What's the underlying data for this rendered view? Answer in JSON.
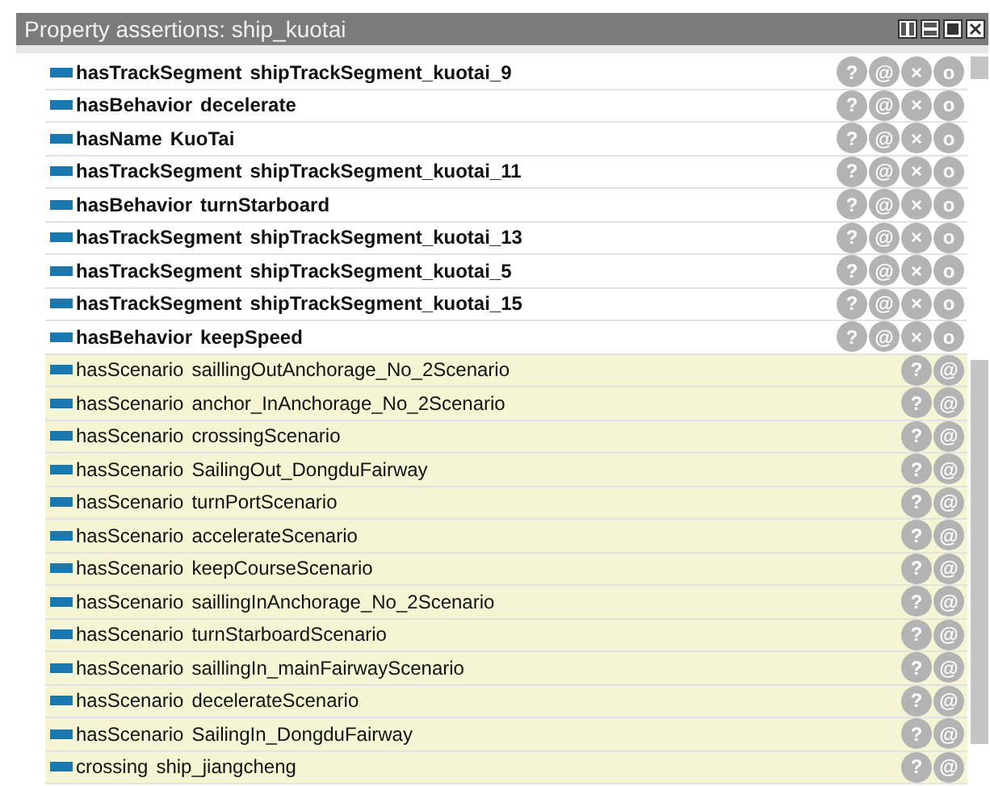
{
  "window": {
    "title": "Property assertions: ship_kuotai"
  },
  "rows": [
    {
      "kind": "asserted",
      "property": "hasTrackSegment",
      "value": "shipTrackSegment_kuotai_9",
      "buttons": [
        "?",
        "@",
        "×",
        "o"
      ]
    },
    {
      "kind": "asserted",
      "property": "hasBehavior",
      "value": "decelerate",
      "buttons": [
        "?",
        "@",
        "×",
        "o"
      ]
    },
    {
      "kind": "asserted",
      "property": "hasName",
      "value": "KuoTai",
      "buttons": [
        "?",
        "@",
        "×",
        "o"
      ]
    },
    {
      "kind": "asserted",
      "property": "hasTrackSegment",
      "value": "shipTrackSegment_kuotai_11",
      "buttons": [
        "?",
        "@",
        "×",
        "o"
      ]
    },
    {
      "kind": "asserted",
      "property": "hasBehavior",
      "value": "turnStarboard",
      "buttons": [
        "?",
        "@",
        "×",
        "o"
      ]
    },
    {
      "kind": "asserted",
      "property": "hasTrackSegment",
      "value": "shipTrackSegment_kuotai_13",
      "buttons": [
        "?",
        "@",
        "×",
        "o"
      ]
    },
    {
      "kind": "asserted",
      "property": "hasTrackSegment",
      "value": "shipTrackSegment_kuotai_5",
      "buttons": [
        "?",
        "@",
        "×",
        "o"
      ]
    },
    {
      "kind": "asserted",
      "property": "hasTrackSegment",
      "value": "shipTrackSegment_kuotai_15",
      "buttons": [
        "?",
        "@",
        "×",
        "o"
      ]
    },
    {
      "kind": "asserted",
      "property": "hasBehavior",
      "value": "keepSpeed",
      "buttons": [
        "?",
        "@",
        "×",
        "o"
      ]
    },
    {
      "kind": "inferred",
      "property": "hasScenario",
      "value": "saillingOutAnchorage_No_2Scenario",
      "buttons": [
        "?",
        "@"
      ]
    },
    {
      "kind": "inferred",
      "property": "hasScenario",
      "value": "anchor_InAnchorage_No_2Scenario",
      "buttons": [
        "?",
        "@"
      ]
    },
    {
      "kind": "inferred",
      "property": "hasScenario",
      "value": "crossingScenario",
      "buttons": [
        "?",
        "@"
      ]
    },
    {
      "kind": "inferred",
      "property": "hasScenario",
      "value": "SailingOut_DongduFairway",
      "buttons": [
        "?",
        "@"
      ]
    },
    {
      "kind": "inferred",
      "property": "hasScenario",
      "value": "turnPortScenario",
      "buttons": [
        "?",
        "@"
      ]
    },
    {
      "kind": "inferred",
      "property": "hasScenario",
      "value": "accelerateScenario",
      "buttons": [
        "?",
        "@"
      ]
    },
    {
      "kind": "inferred",
      "property": "hasScenario",
      "value": "keepCourseScenario",
      "buttons": [
        "?",
        "@"
      ]
    },
    {
      "kind": "inferred",
      "property": "hasScenario",
      "value": "saillingInAnchorage_No_2Scenario",
      "buttons": [
        "?",
        "@"
      ]
    },
    {
      "kind": "inferred",
      "property": "hasScenario",
      "value": "turnStarboardScenario",
      "buttons": [
        "?",
        "@"
      ]
    },
    {
      "kind": "inferred",
      "property": "hasScenario",
      "value": "saillingIn_mainFairwayScenario",
      "buttons": [
        "?",
        "@"
      ]
    },
    {
      "kind": "inferred",
      "property": "hasScenario",
      "value": "decelerateScenario",
      "buttons": [
        "?",
        "@"
      ]
    },
    {
      "kind": "inferred",
      "property": "hasScenario",
      "value": "SailingIn_DongduFairway",
      "buttons": [
        "?",
        "@"
      ]
    },
    {
      "kind": "inferred",
      "property": "crossing",
      "value": "ship_jiangcheng",
      "buttons": [
        "?",
        "@"
      ]
    }
  ]
}
